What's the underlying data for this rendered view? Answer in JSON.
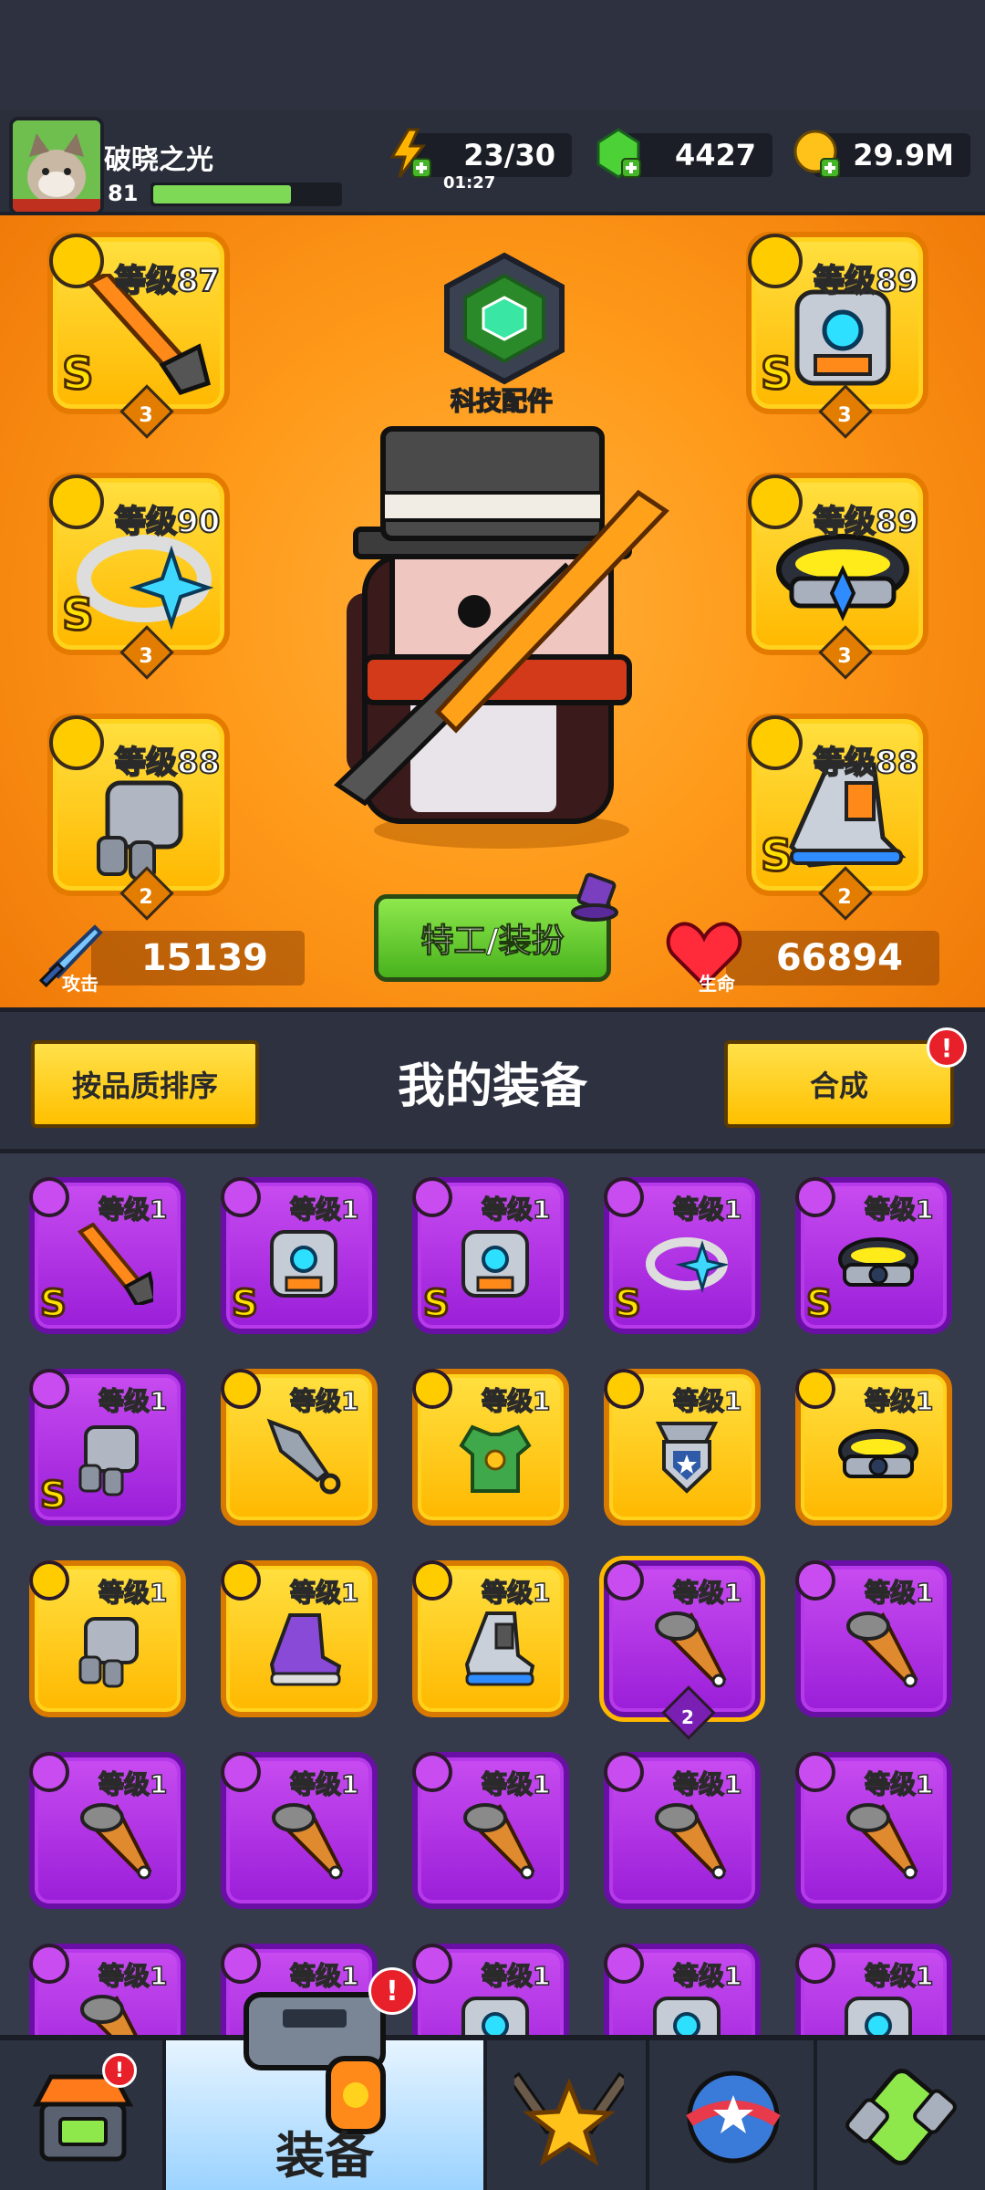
{
  "player": {
    "name": "破晓之光",
    "level": "81",
    "xp_fraction": 0.74
  },
  "resources": {
    "energy": {
      "value": "23/30",
      "timer": "01:27",
      "icon": "lightning-icon"
    },
    "gems": {
      "value": "4427",
      "icon": "green-gem-icon"
    },
    "coins": {
      "value": "29.9M",
      "icon": "gold-coin-icon"
    }
  },
  "hero": {
    "tech_label": "科技配件",
    "costume_button": "特工/装扮",
    "attack": {
      "label": "攻击",
      "value": "15139"
    },
    "hp": {
      "label": "生命",
      "value": "66894"
    }
  },
  "equipped": [
    {
      "slot": "weapon",
      "level": "等级87",
      "rank": "S",
      "stars": "3",
      "icon": "sword-icon"
    },
    {
      "slot": "ring",
      "level": "等级90",
      "rank": "S",
      "stars": "3",
      "icon": "ring-icon"
    },
    {
      "slot": "glove",
      "level": "等级88",
      "rank": "",
      "stars": "2",
      "icon": "gauntlet-icon"
    },
    {
      "slot": "armor",
      "level": "等级89",
      "rank": "S",
      "stars": "3",
      "icon": "armor-icon"
    },
    {
      "slot": "belt",
      "level": "等级89",
      "rank": "",
      "stars": "3",
      "icon": "belt-icon"
    },
    {
      "slot": "boots",
      "level": "等级88",
      "rank": "S",
      "stars": "2",
      "icon": "boots-icon"
    }
  ],
  "inventory_header": {
    "sort_button": "按品质排序",
    "title": "我的装备",
    "merge_button": "合成",
    "merge_badge": "!"
  },
  "inventory": [
    {
      "level": "等级1",
      "color": "purple",
      "rank": "S",
      "icon": "sword-icon"
    },
    {
      "level": "等级1",
      "color": "purple",
      "rank": "S",
      "icon": "armor-icon"
    },
    {
      "level": "等级1",
      "color": "purple",
      "rank": "S",
      "icon": "armor-icon"
    },
    {
      "level": "等级1",
      "color": "purple",
      "rank": "S",
      "icon": "ring-icon"
    },
    {
      "level": "等级1",
      "color": "purple",
      "rank": "S",
      "icon": "belt-icon"
    },
    {
      "level": "等级1",
      "color": "purple",
      "rank": "S",
      "icon": "gauntlet-icon"
    },
    {
      "level": "等级1",
      "color": "yellow",
      "rank": "",
      "icon": "kunai-icon"
    },
    {
      "level": "等级1",
      "color": "yellow",
      "rank": "",
      "icon": "vest-icon"
    },
    {
      "level": "等级1",
      "color": "yellow",
      "rank": "",
      "icon": "pendant-icon"
    },
    {
      "level": "等级1",
      "color": "yellow",
      "rank": "",
      "icon": "belt-icon"
    },
    {
      "level": "等级1",
      "color": "yellow",
      "rank": "",
      "icon": "gauntlet-icon"
    },
    {
      "level": "等级1",
      "color": "yellow",
      "rank": "",
      "icon": "sneaker-icon"
    },
    {
      "level": "等级1",
      "color": "yellow",
      "rank": "",
      "icon": "boots-icon"
    },
    {
      "level": "等级1",
      "color": "purple",
      "rank": "",
      "icon": "cone-icon",
      "stars": "2",
      "selected": true
    },
    {
      "level": "等级1",
      "color": "purple",
      "rank": "",
      "icon": "cone-icon"
    },
    {
      "level": "等级1",
      "color": "purple",
      "rank": "",
      "icon": "cone-icon"
    },
    {
      "level": "等级1",
      "color": "purple",
      "rank": "",
      "icon": "cone-icon"
    },
    {
      "level": "等级1",
      "color": "purple",
      "rank": "",
      "icon": "cone-icon"
    },
    {
      "level": "等级1",
      "color": "purple",
      "rank": "",
      "icon": "cone-icon"
    },
    {
      "level": "等级1",
      "color": "purple",
      "rank": "",
      "icon": "cone-icon"
    },
    {
      "level": "等级1",
      "color": "purple",
      "rank": "",
      "icon": "cone-icon"
    },
    {
      "level": "等级1",
      "color": "purple",
      "rank": "",
      "icon": "armor-icon"
    },
    {
      "level": "等级1",
      "color": "purple",
      "rank": "",
      "icon": "armor-icon"
    },
    {
      "level": "等级1",
      "color": "purple",
      "rank": "",
      "icon": "armor-icon"
    },
    {
      "level": "等级1",
      "color": "purple",
      "rank": "",
      "icon": "armor-icon"
    }
  ],
  "nav": {
    "shop": {
      "icon": "shop-icon",
      "badge": "!"
    },
    "equipment": {
      "label": "装备",
      "icon": "blaster-icon",
      "badge": "!"
    },
    "battle": {
      "icon": "crossed-swords-star-icon"
    },
    "ball": {
      "icon": "star-ball-icon"
    },
    "dna": {
      "icon": "dna-capsule-icon"
    }
  }
}
